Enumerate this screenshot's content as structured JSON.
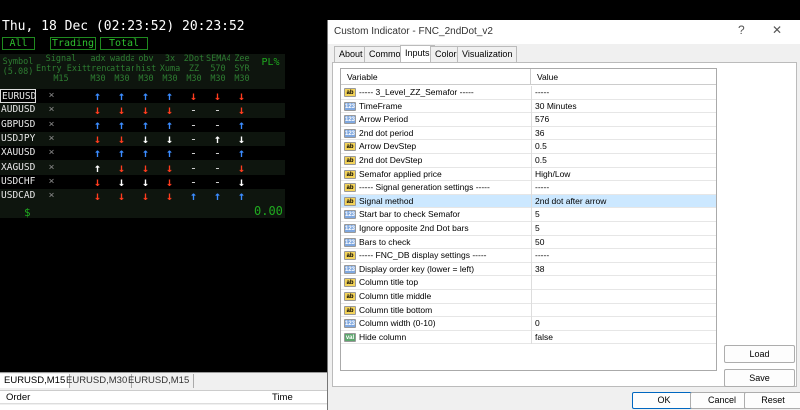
{
  "chart": {
    "clock": "Thu, 18 Dec (02:23:52) 20:23:52",
    "filters": [
      "All",
      "Trading",
      "Total"
    ],
    "headers": {
      "symbol": [
        "Symbol",
        "(5.08)"
      ],
      "signal": [
        "Signal",
        "Entry Exit",
        "M15"
      ],
      "cols": [
        [
          "adx",
          "trend",
          "M30"
        ],
        [
          "wadda",
          "attar",
          "M30"
        ],
        [
          "obv",
          "hist",
          "M30"
        ],
        [
          "3x",
          "Xuma",
          "M30"
        ],
        [
          "2Dot",
          "ZZ",
          "M30"
        ],
        [
          "SEMA4",
          "570",
          "M30"
        ],
        [
          "Zee",
          "SYR",
          "M30"
        ]
      ],
      "pl": "PL%"
    },
    "rows": [
      {
        "symbol": "EURUSD",
        "signal": "×",
        "cells": [
          "↑",
          "↑",
          "↑",
          "↑",
          "↓",
          "↓",
          "↓"
        ],
        "kinds": [
          "up",
          "up",
          "up",
          "up",
          "down",
          "down",
          "down"
        ]
      },
      {
        "symbol": "AUDUSD",
        "signal": "×",
        "cells": [
          "↓",
          "↓",
          "↓",
          "↓",
          "-",
          "-",
          "↓"
        ],
        "kinds": [
          "down",
          "down",
          "down",
          "down",
          "dash",
          "dash",
          "down"
        ]
      },
      {
        "symbol": "GBPUSD",
        "signal": "×",
        "cells": [
          "↑",
          "↑",
          "↑",
          "↑",
          "-",
          "-",
          "↑"
        ],
        "kinds": [
          "up",
          "up",
          "up",
          "up",
          "dash",
          "dash",
          "up"
        ]
      },
      {
        "symbol": "USDJPY",
        "signal": "×",
        "cells": [
          "↓",
          "↓",
          "↓",
          "↓",
          "-",
          "↑",
          "↓"
        ],
        "kinds": [
          "down",
          "down",
          "upw",
          "upw",
          "dash",
          "upw",
          "upw"
        ]
      },
      {
        "symbol": "XAUUSD",
        "signal": "×",
        "cells": [
          "↑",
          "↑",
          "↑",
          "↑",
          "-",
          "-",
          "↑"
        ],
        "kinds": [
          "up",
          "up",
          "up",
          "up",
          "dash",
          "dash",
          "up"
        ]
      },
      {
        "symbol": "XAGUSD",
        "signal": "×",
        "cells": [
          "↑",
          "↓",
          "↓",
          "↓",
          "-",
          "-",
          "↓"
        ],
        "kinds": [
          "upw",
          "down",
          "down",
          "down",
          "dash",
          "dash",
          "down"
        ]
      },
      {
        "symbol": "USDCHF",
        "signal": "×",
        "cells": [
          "↓",
          "↓",
          "↓",
          "↓",
          "-",
          "-",
          "↓"
        ],
        "kinds": [
          "down",
          "downw",
          "downw",
          "down",
          "dash",
          "dash",
          "downw"
        ]
      },
      {
        "symbol": "USDCAD",
        "signal": "×",
        "cells": [
          "↓",
          "↓",
          "↓",
          "↓",
          "↑",
          "↑",
          "↑"
        ],
        "kinds": [
          "down",
          "down",
          "down",
          "down",
          "up",
          "up",
          "up"
        ]
      }
    ],
    "footer_currency": "$",
    "footer_pl": "0.00"
  },
  "terminal": {
    "chart_tabs": [
      "EURUSD,M15",
      "EURUSD,M30",
      "EURUSD,M15"
    ],
    "order_col": "Order",
    "time_col": "Time"
  },
  "dialog": {
    "title": "Custom Indicator - FNC_2ndDot_v2",
    "help": "?",
    "close": "✕",
    "tabs": [
      "About",
      "Common",
      "Inputs",
      "Colors",
      "Visualization"
    ],
    "active_tab": "Inputs",
    "col_variable": "Variable",
    "col_value": "Value",
    "params": [
      {
        "icon": "ab",
        "name": "----- 3_Level_ZZ_Semafor -----",
        "value": "-----"
      },
      {
        "icon": "123",
        "name": "TimeFrame",
        "value": "30 Minutes"
      },
      {
        "icon": "123",
        "name": "Arrow Period",
        "value": "576"
      },
      {
        "icon": "123",
        "name": "2nd dot period",
        "value": "36"
      },
      {
        "icon": "ab",
        "name": "Arrow DevStep",
        "value": "0.5"
      },
      {
        "icon": "ab",
        "name": "2nd dot DevStep",
        "value": "0.5"
      },
      {
        "icon": "ab",
        "name": "Semafor applied price",
        "value": "High/Low"
      },
      {
        "icon": "ab",
        "name": "----- Signal generation settings -----",
        "value": "-----"
      },
      {
        "icon": "ab",
        "name": "Signal method",
        "value": "2nd dot after arrow"
      },
      {
        "icon": "123",
        "name": "Start bar to check Semafor",
        "value": "5"
      },
      {
        "icon": "123",
        "name": "Ignore opposite 2nd Dot bars",
        "value": "5"
      },
      {
        "icon": "123",
        "name": "Bars to check",
        "value": "50"
      },
      {
        "icon": "ab",
        "name": "----- FNC_DB display settings -----",
        "value": "-----"
      },
      {
        "icon": "123",
        "name": "Display order key (lower = left)",
        "value": "38"
      },
      {
        "icon": "ab",
        "name": "Column title top",
        "value": ""
      },
      {
        "icon": "ab",
        "name": "Column title middle",
        "value": ""
      },
      {
        "icon": "ab",
        "name": "Column title bottom",
        "value": ""
      },
      {
        "icon": "123",
        "name": "Column width (0-10)",
        "value": "0"
      },
      {
        "icon": "val",
        "name": "Hide column",
        "value": "false"
      }
    ],
    "highlight_index": 8,
    "load_label": "Load",
    "save_label": "Save",
    "ok_label": "OK",
    "cancel_label": "Cancel",
    "reset_label": "Reset",
    "colors": {
      "up": "#3b8cff",
      "down": "#ff3c1e",
      "panel_green": "#1faa1f"
    }
  }
}
